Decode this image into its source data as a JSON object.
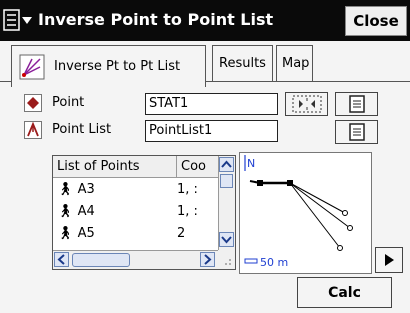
{
  "window": {
    "title": "Inverse Point to Point List",
    "close_label": "Close",
    "menu_icon": "menu-icon"
  },
  "tabs": [
    {
      "label": "Inverse Pt to Pt List",
      "active": true
    },
    {
      "label": "Results",
      "active": false
    },
    {
      "label": "Map",
      "active": false
    }
  ],
  "form": {
    "point_label": "Point",
    "point_value": "STAT1",
    "point_list_label": "Point List",
    "point_list_value": "PointList1"
  },
  "list": {
    "columns": [
      "List of Points",
      "Coo"
    ],
    "rows": [
      {
        "name": "A3",
        "code": "1, :"
      },
      {
        "name": "A4",
        "code": "1, :"
      },
      {
        "name": "A5",
        "code": "2"
      }
    ]
  },
  "map": {
    "north_label": "N",
    "scale_label": "50 m"
  },
  "actions": {
    "calc_label": "Calc"
  },
  "colors": {
    "title_bg": "#0a0a0a",
    "point_icon": "#9b1c1c",
    "scale": "#1f3fd1"
  }
}
